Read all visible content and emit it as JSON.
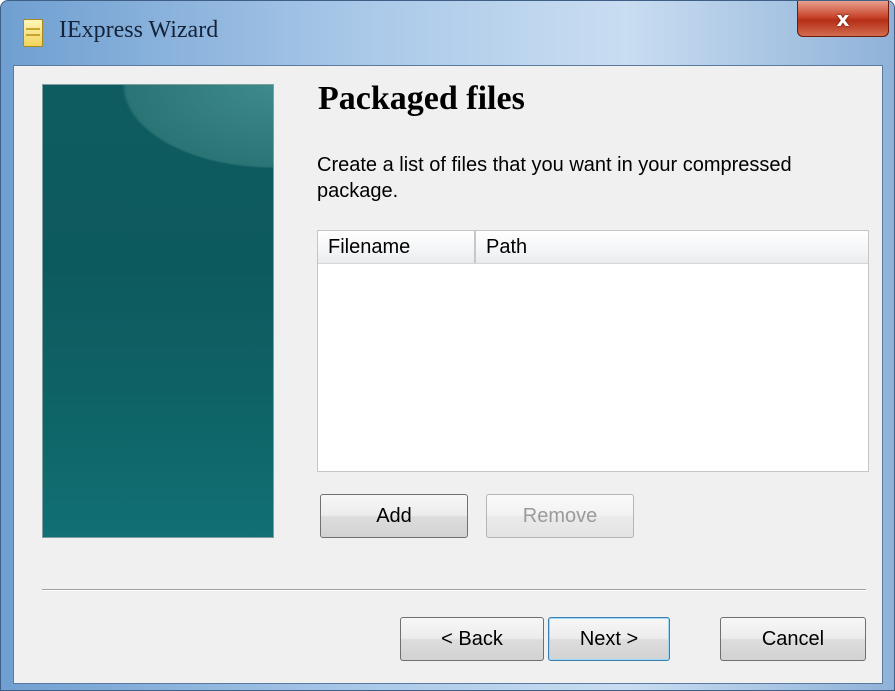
{
  "window": {
    "title": "IExpress Wizard",
    "close_label": "x",
    "icon": "wizard-app-icon"
  },
  "page": {
    "title": "Packaged files",
    "description": "Create a list of files that you want in your compressed package."
  },
  "file_list": {
    "columns": [
      "Filename",
      "Path"
    ],
    "rows": []
  },
  "buttons": {
    "add": "Add",
    "remove": "Remove",
    "back": "< Back",
    "next": "Next >",
    "cancel": "Cancel"
  },
  "colors": {
    "side_panel": "#0f5c60",
    "close_button": "#c9462c"
  }
}
